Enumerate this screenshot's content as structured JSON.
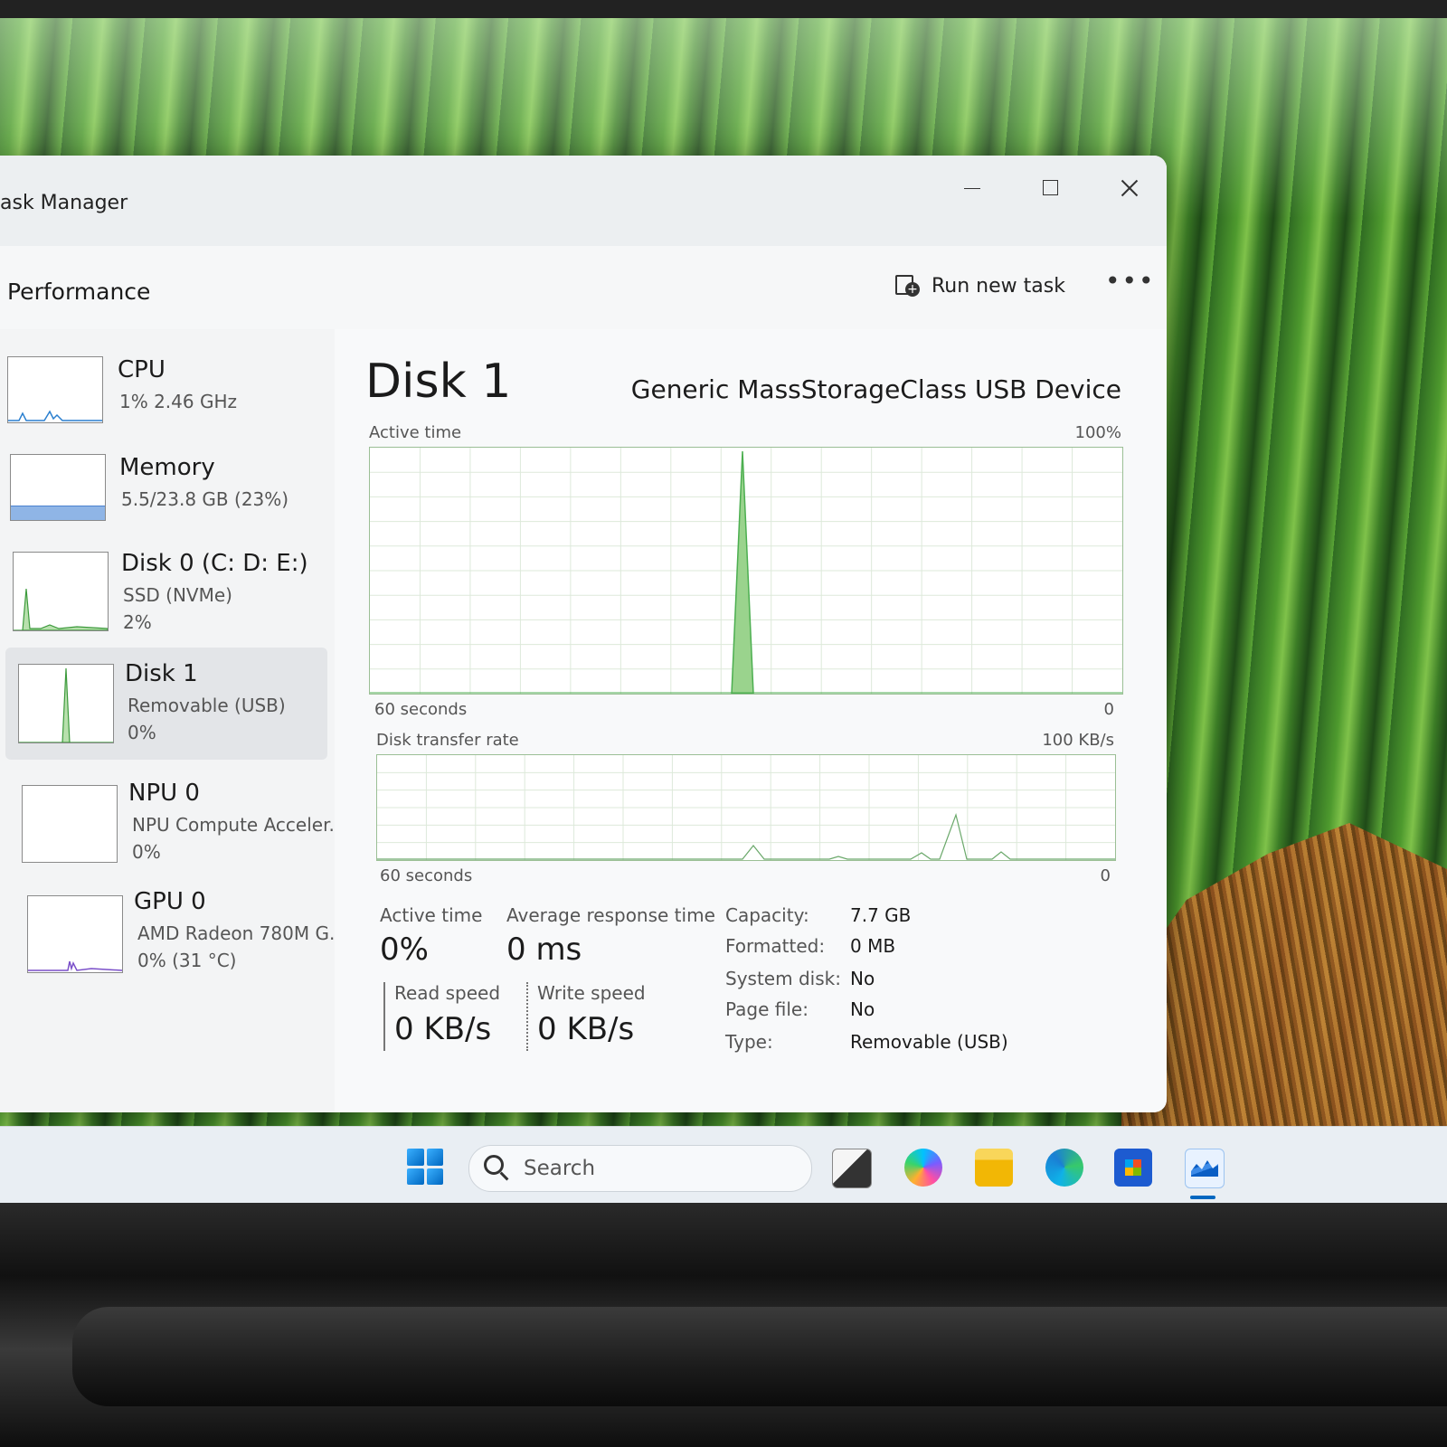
{
  "window": {
    "title": "ask Manager"
  },
  "header": {
    "page_title": "Performance",
    "run_new_task": "Run new task",
    "more": "•••"
  },
  "sidebar": {
    "items": [
      {
        "title": "CPU",
        "line1": "1%  2.46 GHz",
        "line2": ""
      },
      {
        "title": "Memory",
        "line1": "5.5/23.8 GB (23%)",
        "line2": ""
      },
      {
        "title": "Disk 0 (C: D: E:)",
        "line1": "SSD (NVMe)",
        "line2": "2%"
      },
      {
        "title": "Disk 1",
        "line1": "Removable (USB)",
        "line2": "0%"
      },
      {
        "title": "NPU 0",
        "line1": "NPU Compute Acceler...",
        "line2": "0%"
      },
      {
        "title": "GPU 0",
        "line1": "AMD Radeon 780M G...",
        "line2": "0%  (31 °C)"
      }
    ]
  },
  "detail": {
    "title": "Disk 1",
    "device": "Generic MassStorageClass USB Device",
    "active_graph": {
      "label": "Active time",
      "max": "100%",
      "time": "60 seconds",
      "min": "0"
    },
    "transfer_graph": {
      "label": "Disk transfer rate",
      "max": "100 KB/s",
      "time": "60 seconds",
      "min": "0"
    },
    "stats": {
      "active_time_label": "Active time",
      "active_time_value": "0%",
      "avg_response_label": "Average response time",
      "avg_response_value": "0 ms",
      "read_label": "Read speed",
      "read_value": "0 KB/s",
      "write_label": "Write speed",
      "write_value": "0 KB/s"
    },
    "properties": [
      {
        "label": "Capacity:",
        "value": "7.7 GB"
      },
      {
        "label": "Formatted:",
        "value": "0 MB"
      },
      {
        "label": "System disk:",
        "value": "No"
      },
      {
        "label": "Page file:",
        "value": "No"
      },
      {
        "label": "Type:",
        "value": "Removable (USB)"
      }
    ]
  },
  "taskbar": {
    "search_placeholder": "Search"
  },
  "colors": {
    "disk_green": "#4caf50",
    "disk_fill": "#9ad38d",
    "grid": "#d9e8d5",
    "accent": "#0067c0"
  }
}
